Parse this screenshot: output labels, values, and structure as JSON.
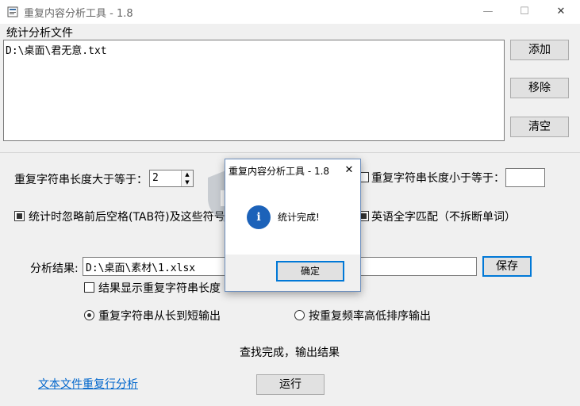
{
  "window": {
    "title": "重复内容分析工具 - 1.8",
    "minimize": "—",
    "maximize": "☐",
    "close": "✕"
  },
  "files": {
    "label": "统计分析文件",
    "items": [
      "D:\\桌面\\君无意.txt"
    ],
    "add_button": "添加",
    "remove_button": "移除",
    "clear_button": "清空"
  },
  "options": {
    "min_length_label": "重复字符串长度大于等于：",
    "min_length_value": "2",
    "max_length_checkbox_label": "重复字符串长度小于等于：",
    "max_length_checked": false,
    "max_length_value": "",
    "ignore_spaces_label": "统计时忽略前后空格(TAB符)及这些符号",
    "ignore_spaces_checked": true,
    "english_whole_word_label": "英语全字匹配（不拆断单词）",
    "english_whole_word_checked": true
  },
  "output": {
    "label": "分析结果:",
    "path": "D:\\桌面\\素材\\1.xlsx",
    "save_button": "保存",
    "show_length_label": "结果显示重复字符串长度",
    "show_length_checked": false,
    "sort_by_length_label": "重复字符串从长到短输出",
    "sort_by_length_checked": true,
    "sort_by_frequency_label": "按重复频率高低排序输出",
    "sort_by_frequency_checked": false
  },
  "status": "查找完成，输出结果",
  "footer": {
    "link": "文本文件重复行分析",
    "run_button": "运行"
  },
  "dialog": {
    "title": "重复内容分析工具 - 1.8",
    "message": "统计完成!",
    "icon": "i",
    "ok_button": "确定",
    "close": "✕"
  },
  "watermark": {
    "text_cn": "安下载",
    "text_en": "anxz.com"
  },
  "colors": {
    "accent": "#0078d7",
    "link": "#0066cc",
    "info_icon": "#1c62b9"
  }
}
